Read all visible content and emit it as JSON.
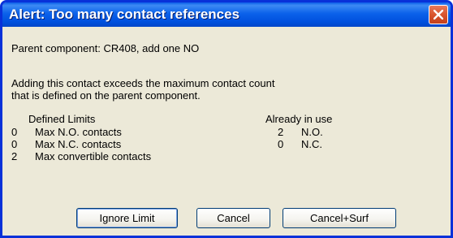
{
  "window": {
    "title": "Alert: Too many contact references"
  },
  "message": {
    "parent_line": "Parent component: CR408, add one NO",
    "body_line1": "Adding this contact exceeds the maximum contact count",
    "body_line2": "that is defined on the parent component."
  },
  "defined_limits": {
    "header": "Defined Limits",
    "rows": [
      {
        "value": "0",
        "label": "Max N.O. contacts"
      },
      {
        "value": "0",
        "label": "Max N.C. contacts"
      },
      {
        "value": "2",
        "label": "Max convertible contacts"
      }
    ]
  },
  "already_in_use": {
    "header": "Already in use",
    "rows": [
      {
        "value": "2",
        "label": "N.O."
      },
      {
        "value": "0",
        "label": "N.C."
      }
    ]
  },
  "buttons": {
    "ignore_limit": "Ignore Limit",
    "cancel": "Cancel",
    "cancel_surf": "Cancel+Surf"
  },
  "icons": {
    "close": "close-icon"
  },
  "colors": {
    "title_bar": "#0058e6",
    "close_button": "#d9552e",
    "dialog_background": "#ece9d8"
  }
}
